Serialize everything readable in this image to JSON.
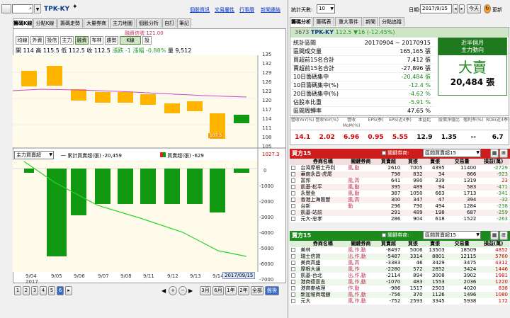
{
  "toolbar": {
    "code": "TPK-KY",
    "links": [
      "個股資訊",
      "交易屬性",
      "行事曆",
      "新聞連結"
    ]
  },
  "left_tabs": [
    "籌碼K線",
    "分點K線",
    "籌碼走勢",
    "大量券商",
    "主力地圖",
    "個股分析",
    "自訂",
    "筆記"
  ],
  "left_subtabs": [
    "均線",
    "外資",
    "投信",
    "主力",
    "融資",
    "布林",
    "趨勢",
    "K線",
    "設"
  ],
  "chart": {
    "tooltip": "融資信號 121.00",
    "ohlc": {
      "open_label": "開",
      "open": "114",
      "high_label": "高",
      "high": "115.5",
      "low_label": "低",
      "low": "112.5",
      "close_label": "收",
      "close": "112.5",
      "change_label": "漲跌",
      "change": "-1",
      "pct_label": "漲幅",
      "pct": "-0.88%",
      "vol_label": "量",
      "vol": "9,512"
    },
    "price_ticks": [
      "135",
      "132",
      "129",
      "126",
      "123",
      "120",
      "117",
      "114",
      "111",
      "108",
      "105"
    ],
    "candle_label": "107.5",
    "lower_select": "主力買賣超",
    "legend1": "一 累計買賣超(張) -20,459",
    "legend2": "買賣超(張) -629",
    "lower_value": "1027.3",
    "lower_ticks": [
      "0",
      "-1000",
      "-2000",
      "-3000",
      "-4000",
      "-5000",
      "-6000",
      "-7000"
    ],
    "x_ticks": [
      "9/04",
      "9/05",
      "9/06",
      "9/07",
      "9/08",
      "9/11",
      "9/12",
      "9/13",
      "9/14"
    ],
    "year": "2017",
    "date_label": "2017/09/15",
    "pages": [
      "1",
      "2",
      "3",
      "4",
      "5",
      "6"
    ],
    "range_buttons": [
      "3月",
      "6月",
      "1年",
      "2年",
      "全部",
      "盤後"
    ]
  },
  "right": {
    "days_label": "統計天數:",
    "days": "10",
    "date_label": "日期:",
    "date": "2017/9/15",
    "today": "今天",
    "refresh": "更新",
    "tabs": [
      "籌碼分析",
      "籌碼表",
      "重大事件",
      "新聞",
      "分點追蹤"
    ],
    "stock_no": "3673",
    "stock_name": "TPK-KY",
    "price": "112.5",
    "change": "▼16 (-12.45%)",
    "stats": [
      {
        "label": "統計區間",
        "value": "20170904 ~ 20170915"
      },
      {
        "label": "區間成交量",
        "value": "165,165 張"
      },
      {
        "label": "買超前15名合計",
        "value": "7,412 張"
      },
      {
        "label": "賣超前15名合計",
        "value": "-27,896 張"
      },
      {
        "label": "10日籌碼集中",
        "value": "-20,484 張"
      },
      {
        "label": "10日籌碼集中(%)",
        "value": "-12.4 %"
      },
      {
        "label": "20日籌碼集中(%)",
        "value": "-4.62 %"
      },
      {
        "label": "佔股本比重",
        "value": "-5.91 %"
      },
      {
        "label": "區間周轉率",
        "value": "47.65 %"
      }
    ],
    "box": {
      "title1": "近半個月",
      "title2": "主力動向",
      "verdict": "大賣",
      "amount": "20,484",
      "unit": "張"
    },
    "fund_headers": [
      "營收YoY(%)",
      "營收YoY(%)",
      "營收MoM(%)",
      "EPS(季)",
      "EPS(近4季)",
      "本益比",
      "股價淨值比",
      "殖利率(%)",
      "ROE(近4季)"
    ],
    "fund_values": [
      "14.1",
      "2.02",
      "6.96",
      "0.95",
      "5.55",
      "12.9",
      "1.35",
      "--",
      "6.7"
    ],
    "buy_title": "買方15",
    "sell_title": "賣方15",
    "related_label": "關鍵券商:",
    "related_select": "區間買賣超15",
    "buy_cols": [
      "券商名稱",
      "關鍵券商",
      "買賣超",
      "買張",
      "賣張",
      "交易量",
      "損益(萬)"
    ],
    "buy_rows": [
      [
        "台灣摩根士丹利",
        "風,動",
        "2610",
        "7005",
        "4395",
        "11400",
        "-2729"
      ],
      [
        "華南永昌-虎尾",
        "",
        "798",
        "832",
        "34",
        "866",
        "-923"
      ],
      [
        "富邦",
        "風,高",
        "641",
        "980",
        "339",
        "1319",
        "23"
      ],
      [
        "凱基-松平",
        "風,動",
        "395",
        "489",
        "94",
        "583",
        "-471"
      ],
      [
        "永豐金",
        "風,動",
        "387",
        "1050",
        "663",
        "1713",
        "-341"
      ],
      [
        "香港上海匯豐",
        "風,高",
        "300",
        "347",
        "47",
        "394",
        "-32"
      ],
      [
        "台新",
        "動",
        "296",
        "790",
        "494",
        "1284",
        "-238"
      ],
      [
        "凱基-站前",
        "",
        "291",
        "489",
        "198",
        "687",
        "-259"
      ],
      [
        "元大-忠孝",
        "",
        "286",
        "904",
        "618",
        "1522",
        "-263"
      ]
    ],
    "sell_cols": [
      "券商名稱",
      "關鍵券商",
      "買賣超",
      "買張",
      "賣張",
      "交易量",
      "損益(萬)"
    ],
    "sell_rows": [
      [
        "美林",
        "風,作,動",
        "-8497",
        "5006",
        "13503",
        "18509",
        "4852"
      ],
      [
        "瑞士信貸",
        "出,作,動",
        "-5487",
        "3314",
        "8801",
        "12115",
        "5760"
      ],
      [
        "美商高盛",
        "風,高",
        "-3383",
        "46",
        "3429",
        "3475",
        "4312"
      ],
      [
        "摩根大通",
        "風,作",
        "-2280",
        "572",
        "2852",
        "3424",
        "1446"
      ],
      [
        "凱基-台北",
        "出,作,動",
        "-2114",
        "894",
        "3008",
        "3902",
        "1981"
      ],
      [
        "港商德意志",
        "風,作,動",
        "-1070",
        "483",
        "1553",
        "2036",
        "1220"
      ],
      [
        "港商麥格理",
        "作,動",
        "-986",
        "1517",
        "2503",
        "4020",
        "838"
      ],
      [
        "新加坡商瑞銀",
        "風,作,動",
        "-756",
        "370",
        "1126",
        "1496",
        "1080"
      ],
      [
        "元大",
        "風,作,動",
        "-752",
        "2593",
        "3345",
        "5938",
        "172"
      ]
    ]
  }
}
